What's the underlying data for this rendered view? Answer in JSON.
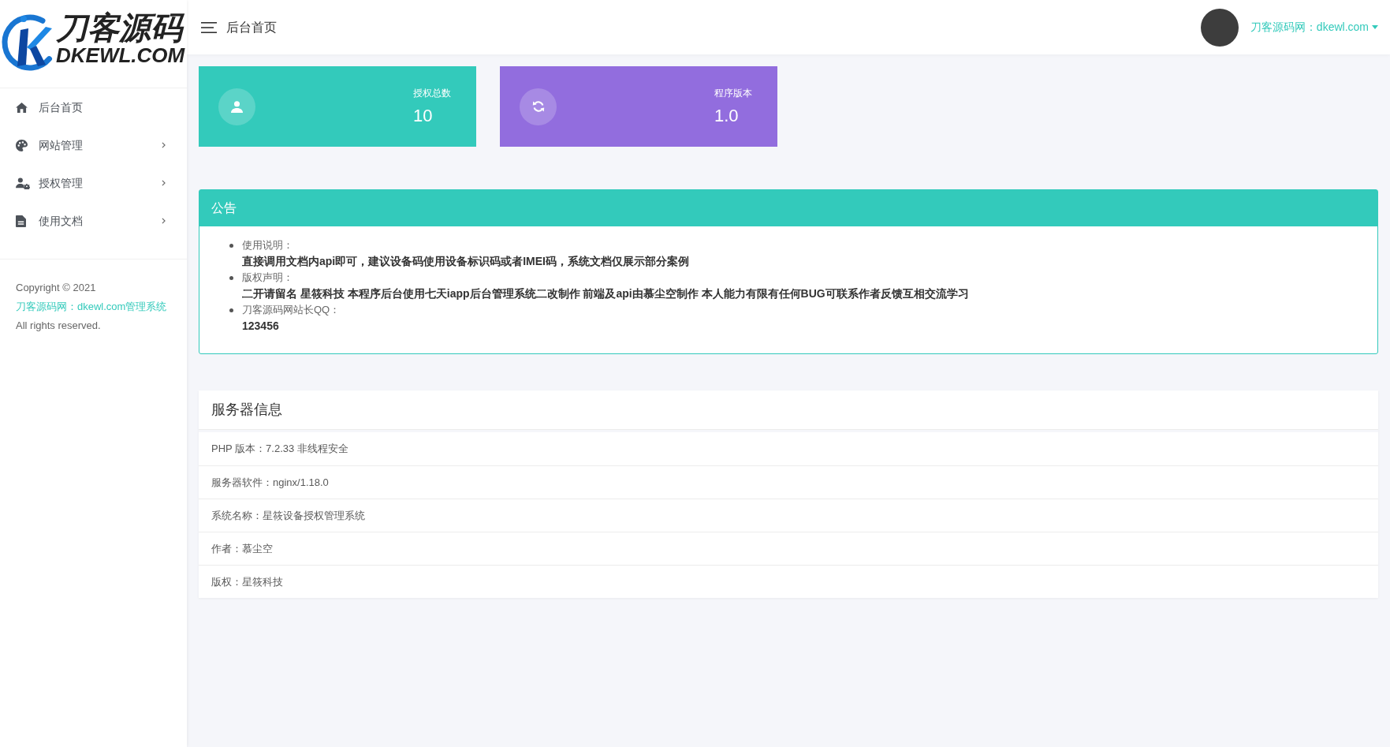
{
  "sidebar": {
    "logo": {
      "title": "刀客源码",
      "subtitle": "DKEWL.COM"
    },
    "menu": [
      {
        "label": "后台首页",
        "kind": "link"
      },
      {
        "label": "网站管理",
        "kind": "submenu"
      },
      {
        "label": "授权管理",
        "kind": "submenu"
      },
      {
        "label": "使用文档",
        "kind": "submenu"
      }
    ],
    "copyright": {
      "prefix": "Copyright © 2021",
      "link": "刀客源码网：dkewl.com管理系统",
      "suffix": "All rights reserved."
    }
  },
  "header": {
    "title": "后台首页",
    "user": "刀客源码网：dkewl.com"
  },
  "stats": [
    {
      "label": "授权总数",
      "value": "10",
      "color": "#33cabb"
    },
    {
      "label": "程序版本",
      "value": "1.0",
      "color": "#926dde"
    }
  ],
  "notice": {
    "title": "公告",
    "items": [
      {
        "label": "使用说明：",
        "text": "直接调用文档内api即可，建议设备码使用设备标识码或者IMEI码，系统文档仅展示部分案例"
      },
      {
        "label": "版权声明：",
        "text": "二开请留名 星筱科技 本程序后台使用七天iapp后台管理系统二改制作 前端及api由慕尘空制作 本人能力有限有任何BUG可联系作者反馈互相交流学习"
      },
      {
        "label": "刀客源码网站长QQ：",
        "text": "123456"
      }
    ]
  },
  "server_info": {
    "title": "服务器信息",
    "rows": [
      "PHP 版本：7.2.33 非线程安全",
      "服务器软件：nginx/1.18.0",
      "系统名称：星筱设备授权管理系统",
      "作者：慕尘空",
      "版权：星筱科技"
    ]
  }
}
